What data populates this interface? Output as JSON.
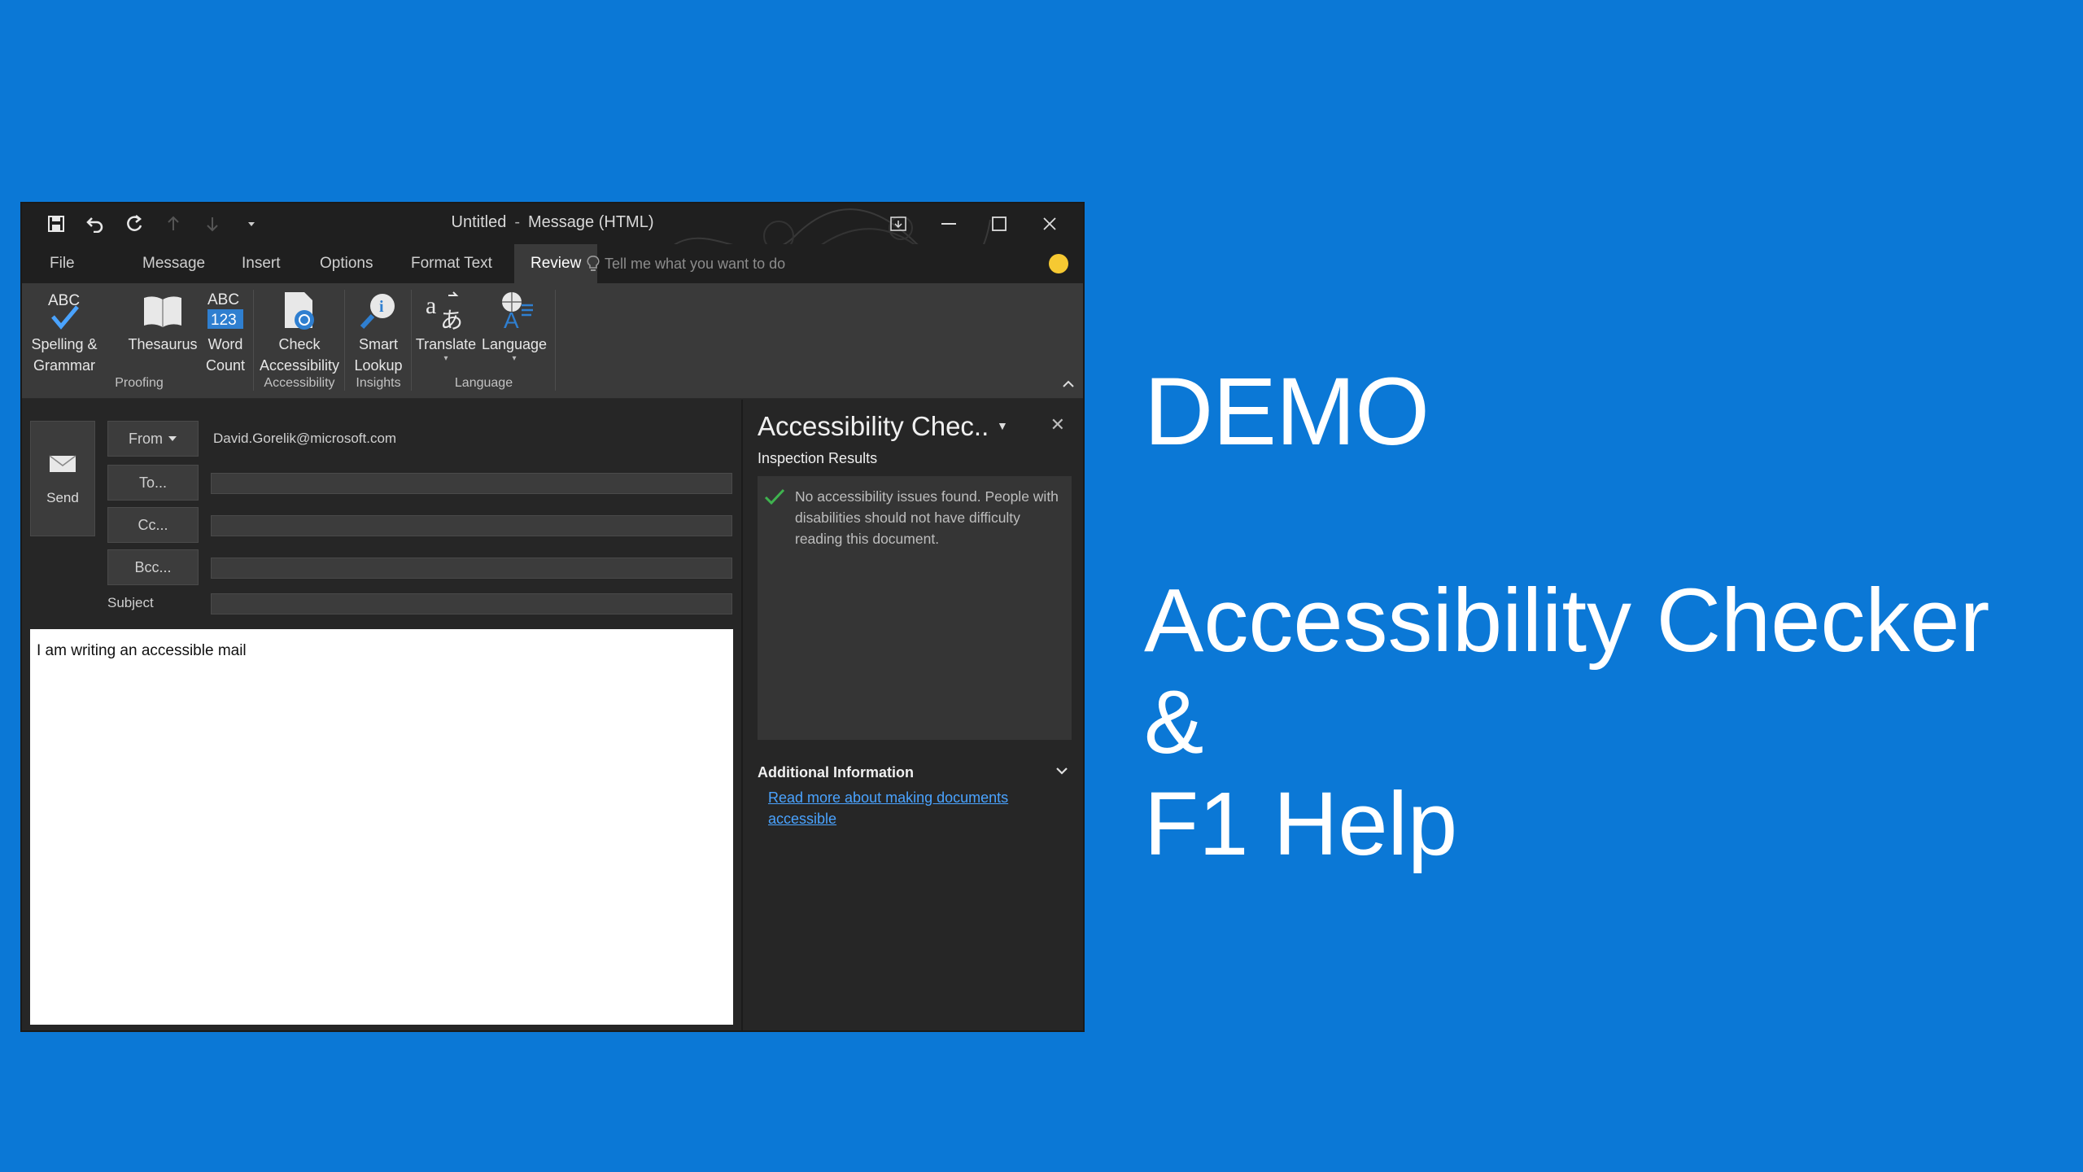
{
  "window": {
    "title_main": "Untitled",
    "title_sep": "-",
    "title_sub": "Message (HTML)",
    "tabs": [
      "File",
      "Message",
      "Insert",
      "Options",
      "Format Text",
      "Review"
    ],
    "active_tab": "Review",
    "tell_me_placeholder": "Tell me what you want to do"
  },
  "ribbon": {
    "buttons": {
      "spelling": "Spelling &\nGrammar",
      "thesaurus": "Thesaurus",
      "word_count": "Word\nCount",
      "check_accessibility": "Check\nAccessibility",
      "smart_lookup": "Smart\nLookup",
      "translate": "Translate",
      "language": "Language"
    },
    "groups": {
      "proofing": "Proofing",
      "accessibility": "Accessibility",
      "insights": "Insights",
      "language": "Language"
    }
  },
  "compose": {
    "send_label": "Send",
    "from_label": "From",
    "from_address": "David.Gorelik@microsoft.com",
    "to_label": "To...",
    "cc_label": "Cc...",
    "bcc_label": "Bcc...",
    "subject_label": "Subject",
    "body_text": "I am writing an accessible mail"
  },
  "pane": {
    "title": "Accessibility Chec..",
    "inspection_results": "Inspection Results",
    "result_message": "No accessibility issues found. People with disabilities should not have difficulty reading this document.",
    "additional_information": "Additional Information",
    "read_more_link": "Read more about making documents accessible"
  },
  "slide": {
    "demo": "DEMO",
    "line1": "Accessibility Checker",
    "line2": "&",
    "line3": "F1 Help"
  },
  "colors": {
    "background": "#0b78d6",
    "window": "#262626",
    "link": "#4aa3ff",
    "check": "#3fb34f"
  }
}
